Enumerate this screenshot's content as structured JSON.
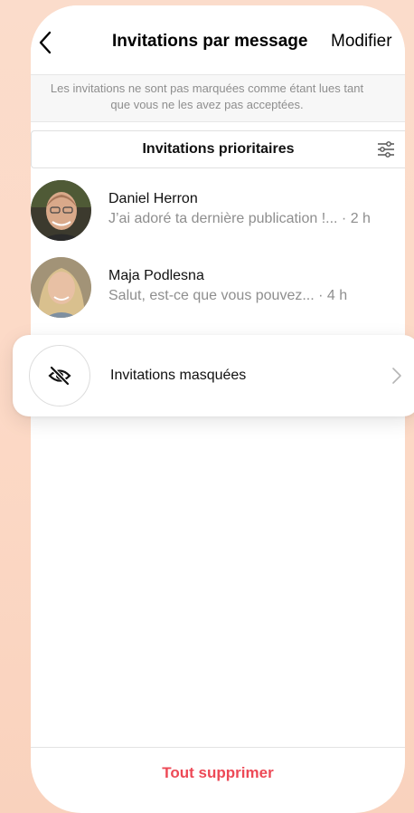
{
  "header": {
    "title": "Invitations par message",
    "edit_label": "Modifier",
    "back_icon": "chevron-left-icon"
  },
  "notice": {
    "line1": "Les invitations ne sont pas marquées comme étant lues tant",
    "line2": "que vous ne les avez pas acceptées."
  },
  "priority": {
    "label": "Invitations prioritaires",
    "filter_icon": "sliders-icon"
  },
  "requests": [
    {
      "name": "Daniel Herron",
      "preview": "J’ai adoré ta dernière publication !... · 2 h"
    },
    {
      "name": "Maja Podlesna",
      "preview": "Salut, est-ce que vous pouvez... · 4 h"
    }
  ],
  "hidden": {
    "label": "Invitations masquées",
    "icon": "eye-off-icon"
  },
  "footer": {
    "delete_all_label": "Tout supprimer"
  },
  "colors": {
    "danger": "#ed4956",
    "secondary_text": "#8e8e8e",
    "background": "#fbdccb"
  }
}
